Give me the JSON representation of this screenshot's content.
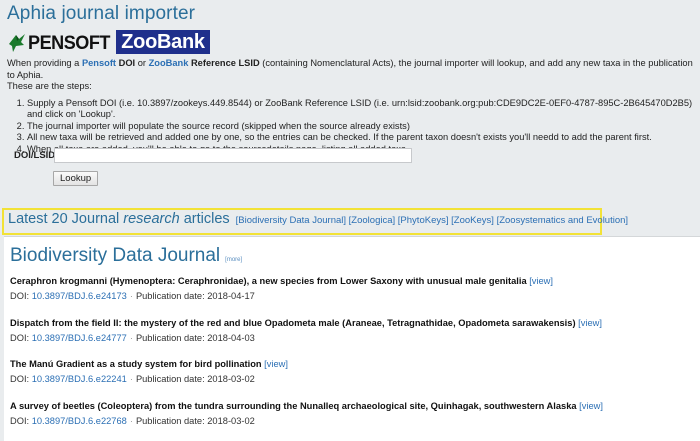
{
  "page": {
    "title": "Aphia journal importer"
  },
  "logos": {
    "pensoft": "PENSOFT",
    "zoobank": "ZooBank"
  },
  "intro": {
    "p1_a": "When providing a ",
    "pensoft_doi": "Pensoft",
    "p1_b": " DOI",
    "p1_c": " or ",
    "zoobank_ref": "ZooBank",
    "p1_d": " Reference LSID",
    "p1_e": " (containing Nomenclatural Acts), the journal importer will lookup, and add any new taxa in the publication to Aphia.",
    "p2": "These are the steps:",
    "steps": [
      "Supply a Pensoft DOI (i.e. 10.3897/zookeys.449.8544) or ZooBank Reference LSID (i.e. urn:lsid:zoobank.org:pub:CDE9DC2E-0EF0-4787-895C-2B645470D2B5) and click on 'Lookup'.",
      "The journal importer will populate the source record (skipped when the source already exists)",
      "All new taxa will be retrieved and added one by one, so the entries can be checked. If the parent taxon doesn't exists you'll needd to add the parent first.",
      "When all taxa are added, you'll be able to go to the sourcedetails page, listing all added taxa."
    ]
  },
  "form": {
    "doi_label": "DOI/LSID",
    "doi_value": "",
    "lookup_label": "Lookup"
  },
  "latest": {
    "prefix": "Latest 20 Journal ",
    "emph": "research",
    "suffix": " articles",
    "journals": [
      "[Biodiversity Data Journal]",
      "[Zoologica]",
      "[PhytoKeys]",
      "[ZooKeys]",
      "[Zoosystematics and Evolution]"
    ]
  },
  "journal": {
    "name": "Biodiversity Data Journal",
    "more": "[more]"
  },
  "articles": [
    {
      "title": "Ceraphron krogmanni (Hymenoptera: Ceraphronidae), a new species from Lower Saxony with unusual male genitalia",
      "view": "[view]",
      "doi_label": "DOI: ",
      "doi": "10.3897/BDJ.6.e24173",
      "date": "Publication date: 2018-04-17"
    },
    {
      "title": "Dispatch from the field II: the mystery of the red and blue Opadometa male (Araneae, Tetragnathidae, Opadometa sarawakensis)",
      "view": "[view]",
      "doi_label": "DOI: ",
      "doi": "10.3897/BDJ.6.e24777",
      "date": "Publication date: 2018-04-03"
    },
    {
      "title": "The Manú Gradient as a study system for bird pollination",
      "view": "[view]",
      "doi_label": "DOI: ",
      "doi": "10.3897/BDJ.6.e22241",
      "date": "Publication date: 2018-03-02"
    },
    {
      "title": "A survey of beetles (Coleoptera) from the tundra surrounding the Nunalleq archaeological site, Quinhagak, southwestern Alaska",
      "view": "[view]",
      "doi_label": "DOI: ",
      "doi": "10.3897/BDJ.6.e22768",
      "date": "Publication date: 2018-03-02"
    }
  ],
  "colors": {
    "accent": "#2b6f9a",
    "link": "#2b6fb4",
    "highlight": "#f2e236",
    "zoobank": "#1f2f8c"
  }
}
